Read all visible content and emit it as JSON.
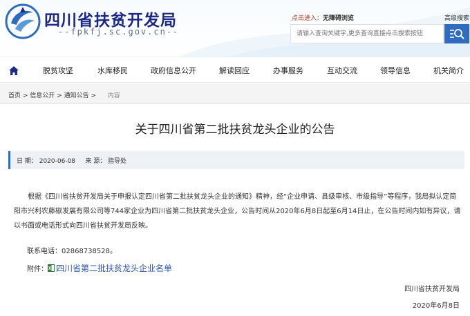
{
  "header": {
    "site_title": "四川省扶贫开发局",
    "site_domain": "--fpkfj.sc.gov.cn--",
    "access_prefix": "点击进入：",
    "access_link": "无障碍浏览",
    "advanced_search": "高级搜索",
    "search_placeholder": "请输入查询关键字,更多查询直接点击搜索按钮"
  },
  "nav": {
    "items": [
      "脱贫攻坚",
      "水库移民",
      "政府信息公开",
      "解读回应",
      "办事服务",
      "互动交流",
      "领导信息",
      "机关简介"
    ]
  },
  "breadcrumb": {
    "home": "首页",
    "sep": " > ",
    "level1": "信息公开",
    "level2": "通知公告",
    "current": "内容"
  },
  "article": {
    "title": "关于四川省第二批扶贫龙头企业的公告",
    "meta": "日 期： 2020-06-08     来 源： 指导处",
    "paragraph": "根据《四川省扶贫开发局关于申报认定四川省第二批扶贫龙头企业的通知》精神，经“企业申请、县级审核、市级指导”等程序，我局拟认定简阳市兴利农藤椒发展有限公司等744家企业为四川省第二批扶贫龙头企业，公告时间从2020年6月8日起至6月14日止，在公告时间内如有异议，请以书面或电话形式向四川省扶贫开发局反映。",
    "contact": "联系电话：02868738528。",
    "attachment_label": "附件：",
    "attachment_link": "四川省第二批扶贫龙头企业名单",
    "sign_org": "四川省扶贫开发局",
    "sign_date": "2020年6月8日"
  },
  "colors": {
    "brand_blue": "#1c2a86",
    "accent_blue": "#2f6bc0",
    "link_blue": "#2a57b0",
    "access_red": "#b43a2a"
  },
  "icons": {
    "home": "home-icon",
    "search": "search-icon",
    "attachment": "excel-file-icon",
    "logo": "logo-emblem"
  }
}
